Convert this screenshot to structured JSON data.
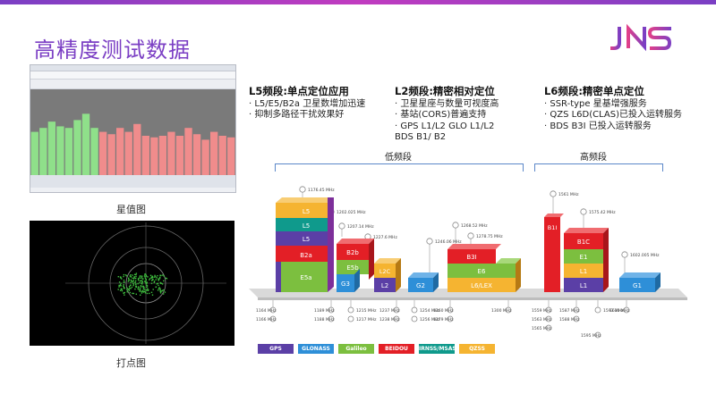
{
  "title": "高精度测试数据",
  "logo_text": "JNS",
  "captions": {
    "satellite": "星值图",
    "dots": "打点图"
  },
  "sections": [
    {
      "heading": "L5频段:单点定位应用",
      "lines": [
        "· L5/E5/B2a 卫星数增加迅速",
        "· 抑制多路径干扰效果好"
      ]
    },
    {
      "heading": "L2频段:精密相对定位",
      "lines": [
        "· 卫星星座与数量可视度高",
        "· 基站(CORS)普遍支持",
        "· GPS L1/L2  GLO L1/L2",
        "  BDS B1/ B2"
      ]
    },
    {
      "heading": "L6频段:精密单点定位",
      "lines": [
        "· SSR-type 星基增强服务",
        "· QZS L6D(CLAS)已投入运转服务",
        "· BDS B3I 已投入运转服务"
      ]
    }
  ],
  "bands": {
    "low": "低频段",
    "high": "高频段"
  },
  "blocks": [
    {
      "label": "L5",
      "color": "#f5b431"
    },
    {
      "label": "L5",
      "color": "#0f9a8c"
    },
    {
      "label": "L5",
      "color": "#5b3fa6"
    },
    {
      "label": "B2a",
      "color": "#e31f26"
    },
    {
      "label": "E5a",
      "color": "#7cbf3f"
    },
    {
      "label": "B2b",
      "color": "#e31f26"
    },
    {
      "label": "E5b",
      "color": "#7cbf3f"
    },
    {
      "label": "G3",
      "color": "#2e8fd8"
    },
    {
      "label": "L2C",
      "color": "#f5b431"
    },
    {
      "label": "L2",
      "color": "#5b3fa6"
    },
    {
      "label": "G2",
      "color": "#2e8fd8"
    },
    {
      "label": "B3I",
      "color": "#e31f26"
    },
    {
      "label": "E6",
      "color": "#7cbf3f"
    },
    {
      "label": "L6/LEX",
      "color": "#f5b431"
    },
    {
      "label": "B1I",
      "color": "#e31f26"
    },
    {
      "label": "B1C",
      "color": "#e31f26"
    },
    {
      "label": "E1",
      "color": "#7cbf3f"
    },
    {
      "label": "L1",
      "color": "#f5b431"
    },
    {
      "label": "L1",
      "color": "#5b3fa6"
    },
    {
      "label": "G1",
      "color": "#2e8fd8"
    }
  ],
  "freq_top": [
    "1176.45 MHz",
    "1202.025 MHz",
    "1207.14 MHz",
    "1227.6 MHz",
    "1246.06 MHz",
    "1268.52 MHz",
    "1278.75 MHz",
    "1561 MHz",
    "1575.42 MHz",
    "1602.005 MHz"
  ],
  "freq_bottom": [
    "1164 MHz",
    "1189 MHz",
    "1215 MHz",
    "1237 MHz",
    "1254 MHz",
    "1260 MHz",
    "1300 MHz",
    "1559 MHz",
    "1587 MHz",
    "1593 MHz",
    "1610 MHz",
    "1166 MHz",
    "1188 MHz",
    "1217 MHz",
    "1238 MHz",
    "1256 MHz",
    "1279 MHz",
    "1563 MHz",
    "1588 MHz",
    "1565 MHz",
    "1595 MHz"
  ],
  "legend": [
    {
      "label": "GPS",
      "color": "#5b3fa6"
    },
    {
      "label": "GLONASS",
      "color": "#2e8fd8"
    },
    {
      "label": "Galileo",
      "color": "#7cbf3f"
    },
    {
      "label": "BEIDOU",
      "color": "#e31f26"
    },
    {
      "label": "IRNSS/MSAS",
      "color": "#0f9a8c"
    },
    {
      "label": "QZSS",
      "color": "#f5b431"
    }
  ],
  "bar_values": [
    0.55,
    0.6,
    0.68,
    0.62,
    0.6,
    0.7,
    0.78,
    0.6,
    0.55,
    0.52,
    0.6,
    0.55,
    0.65,
    0.5,
    0.48,
    0.5,
    0.55,
    0.5,
    0.6,
    0.52,
    0.45,
    0.55,
    0.5,
    0.48
  ]
}
